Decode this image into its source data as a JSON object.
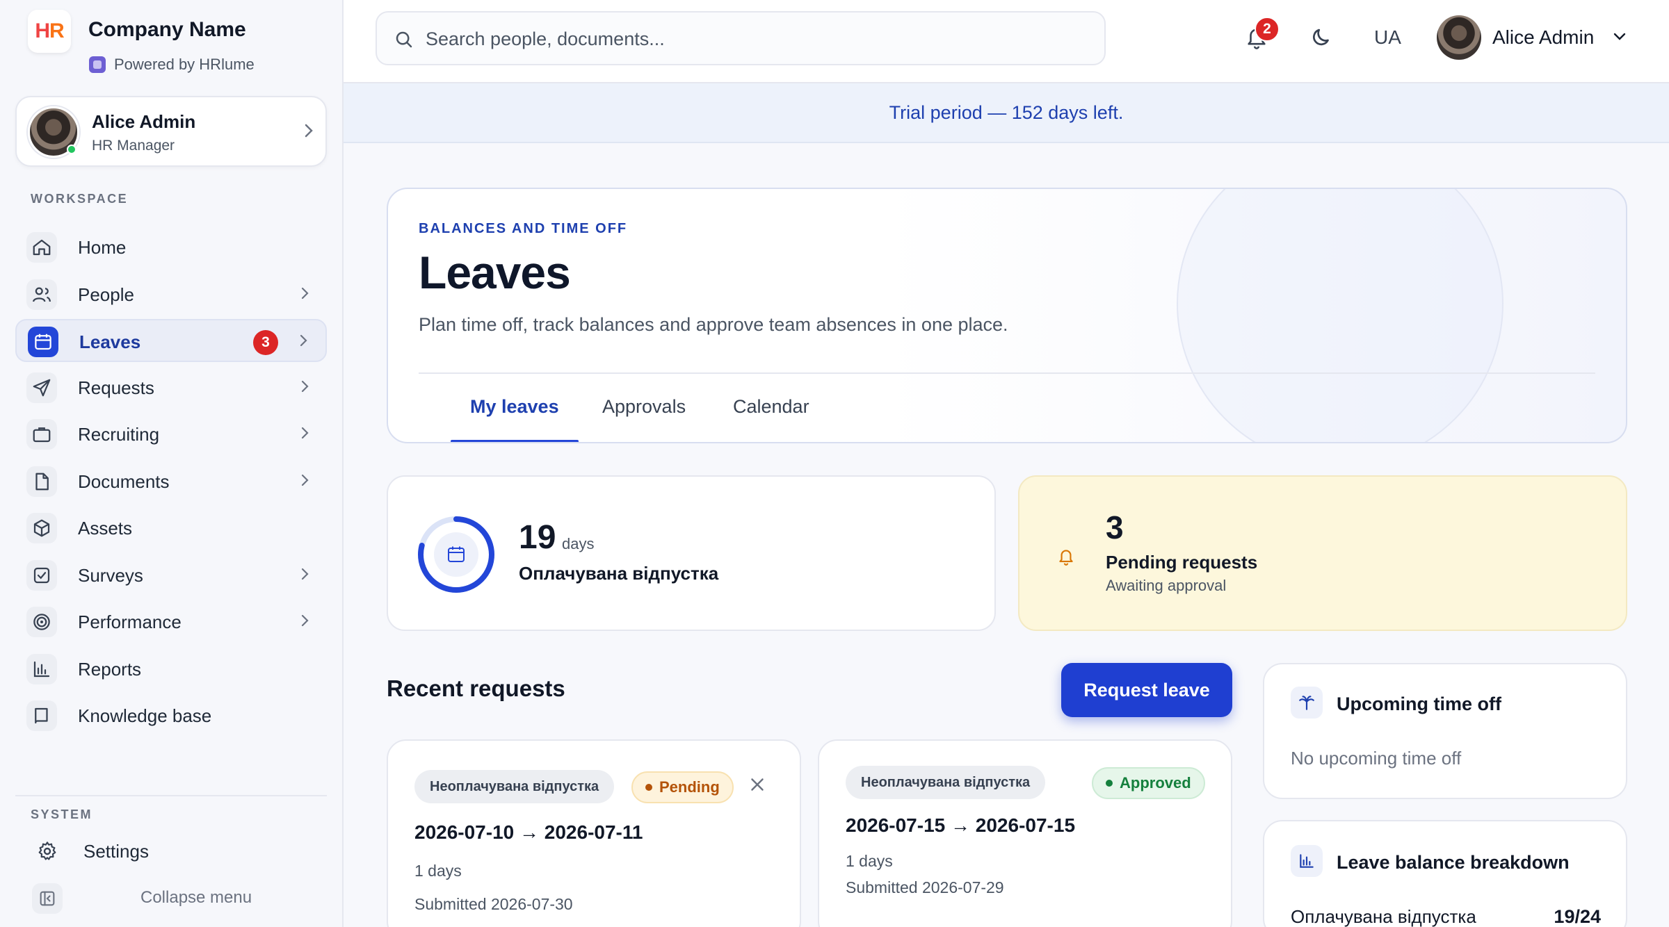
{
  "brand": {
    "logo_text": "HR",
    "name": "Company Name",
    "powered_by": "Powered by HRlume"
  },
  "user": {
    "name": "Alice Admin",
    "role": "HR Manager"
  },
  "sidebar": {
    "workspace_label": "WORKSPACE",
    "items": [
      {
        "label": "Home",
        "icon": "home-icon",
        "chevron": false
      },
      {
        "label": "People",
        "icon": "people-icon",
        "chevron": true
      },
      {
        "label": "Leaves",
        "icon": "calendar-icon",
        "chevron": true,
        "badge": "3",
        "active": true
      },
      {
        "label": "Requests",
        "icon": "send-icon",
        "chevron": true
      },
      {
        "label": "Recruiting",
        "icon": "briefcase-icon",
        "chevron": true
      },
      {
        "label": "Documents",
        "icon": "document-icon",
        "chevron": true
      },
      {
        "label": "Assets",
        "icon": "box-icon",
        "chevron": false
      },
      {
        "label": "Surveys",
        "icon": "checkbox-icon",
        "chevron": true
      },
      {
        "label": "Performance",
        "icon": "target-icon",
        "chevron": true
      },
      {
        "label": "Reports",
        "icon": "bar-chart-icon",
        "chevron": false
      },
      {
        "label": "Knowledge base",
        "icon": "book-icon",
        "chevron": false
      }
    ],
    "system_label": "SYSTEM",
    "settings_label": "Settings",
    "collapse_label": "Collapse menu"
  },
  "topbar": {
    "search_placeholder": "Search people, documents...",
    "notifications_count": "2",
    "language": "UA",
    "user_name": "Alice Admin"
  },
  "trial_banner": "Trial period — 152 days left.",
  "hero": {
    "eyebrow": "BALANCES AND TIME OFF",
    "title": "Leaves",
    "subtitle": "Plan time off, track balances and approve team absences in one place.",
    "tabs": [
      {
        "label": "My leaves",
        "active": true
      },
      {
        "label": "Approvals",
        "active": false
      },
      {
        "label": "Calendar",
        "active": false
      }
    ]
  },
  "stats": {
    "balance": {
      "value": "19",
      "unit": "days",
      "label": "Оплачувана відпустка",
      "fraction": 0.79
    },
    "pending": {
      "value": "3",
      "title": "Pending requests",
      "subtitle": "Awaiting approval"
    }
  },
  "recent": {
    "title": "Recent requests",
    "request_button": "Request leave",
    "items": [
      {
        "type": "Неоплачувана відпустка",
        "status": "Pending",
        "dates": "2026-07-10 → 2026-07-11",
        "duration": "1 days",
        "submitted": "Submitted 2026-07-30"
      },
      {
        "type": "Неоплачувана відпустка",
        "status": "Approved",
        "dates": "2026-07-15 → 2026-07-15",
        "duration": "1 days",
        "submitted": "Submitted 2026-07-29"
      }
    ]
  },
  "upcoming": {
    "title": "Upcoming time off",
    "empty": "No upcoming time off"
  },
  "breakdown": {
    "title": "Leave balance breakdown",
    "rows": [
      {
        "label": "Оплачувана відпустка",
        "value": "19/24"
      }
    ]
  },
  "colors": {
    "accent": "#2346d8",
    "danger": "#dc2626",
    "pending": "#b45309",
    "approved": "#15803d",
    "trial_text": "#1e40af"
  }
}
